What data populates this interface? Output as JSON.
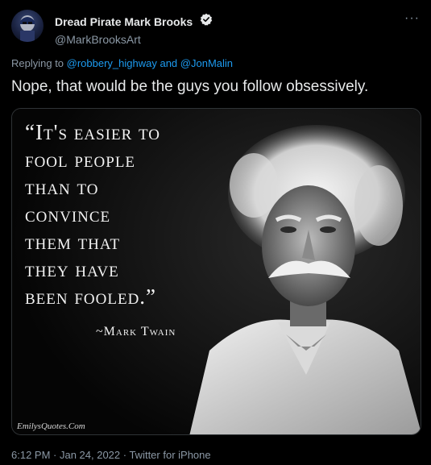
{
  "author": {
    "display_name": "Dread Pirate Mark Brooks",
    "handle": "@MarkBrooksArt"
  },
  "menu": {
    "more_label": "···"
  },
  "reply": {
    "prefix": "Replying to ",
    "mention_1": "@robbery_highway",
    "joiner": " and ",
    "mention_2": "@JonMalin"
  },
  "tweet": {
    "text": "Nope, that would be the guys you follow obsessively."
  },
  "media": {
    "quote_lines": [
      "“It's easier to",
      "fool people",
      "than to",
      "convince",
      "them that",
      "they have",
      "been fooled.”"
    ],
    "attribution": "~Mark Twain",
    "watermark": "EmilysQuotes.Com"
  },
  "footer": {
    "timestamp": "6:12 PM · Jan 24, 2022 · Twitter for iPhone"
  },
  "colors": {
    "background": "#000000",
    "text": "#e7e9ea",
    "secondary": "#8b98a5",
    "link": "#1d9bf0"
  }
}
